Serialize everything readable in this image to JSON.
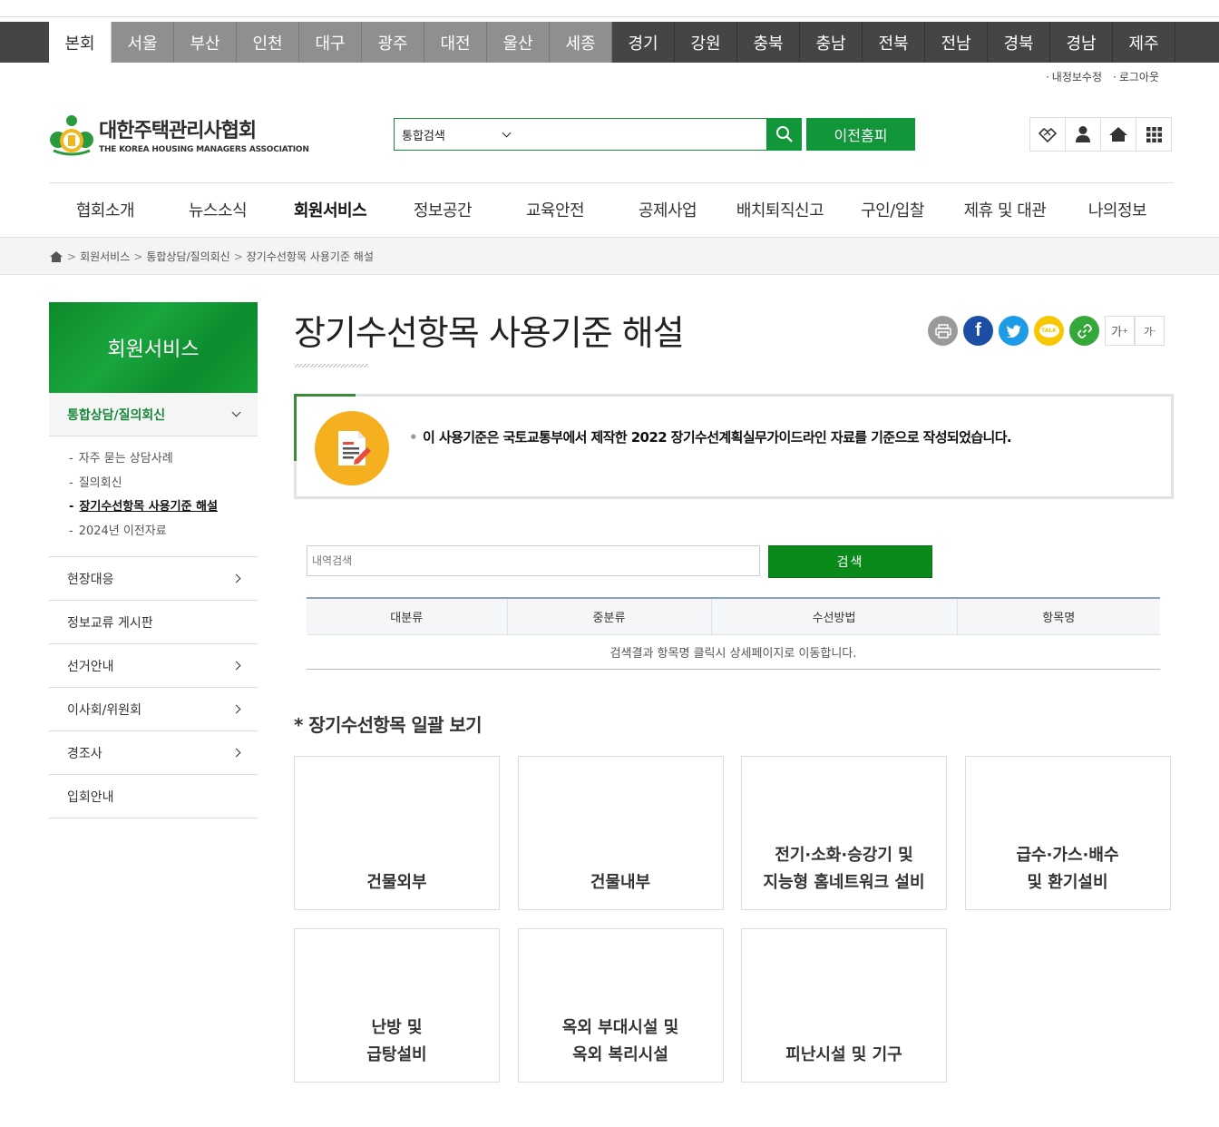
{
  "regions": [
    "본회",
    "서울",
    "부산",
    "인천",
    "대구",
    "광주",
    "대전",
    "울산",
    "세종",
    "경기",
    "강원",
    "충북",
    "충남",
    "전북",
    "전남",
    "경북",
    "경남",
    "제주"
  ],
  "util_links": {
    "edit_info": "내정보수정",
    "logout": "로그아웃"
  },
  "logo": {
    "name_ko": "대한주택관리사협회",
    "name_en": "THE KOREA HOUSING MANAGERS ASSOCIATION"
  },
  "search": {
    "scope": "통합검색",
    "prev_home": "이전홈피"
  },
  "gnb": [
    "협회소개",
    "뉴스소식",
    "회원서비스",
    "정보공간",
    "교육안전",
    "공제사업",
    "배치퇴직신고",
    "구인/입찰",
    "제휴 및 대관",
    "나의정보"
  ],
  "breadcrumb": [
    "회원서비스",
    "통합상담/질의회신",
    "장기수선항목 사용기준 해설"
  ],
  "sidebar": {
    "title": "회원서비스",
    "active": "통합상담/질의회신",
    "sub": [
      "자주 묻는 상담사례",
      "질의회신",
      "장기수선항목 사용기준 해설",
      "2024년 이전자료"
    ],
    "items": [
      {
        "label": "현장대응",
        "arrow": true
      },
      {
        "label": "정보교류 게시판",
        "arrow": false
      },
      {
        "label": "선거안내",
        "arrow": true
      },
      {
        "label": "이사회/위원회",
        "arrow": true
      },
      {
        "label": "경조사",
        "arrow": true
      },
      {
        "label": "입회안내",
        "arrow": false
      }
    ]
  },
  "page": {
    "title": "장기수선항목 사용기준 해설",
    "notice": "이 사용기준은 국토교통부에서 제작한 2022 장기수선계획실무가이드라인 자료를 기준으로 작성되었습니다.",
    "font_up": "가",
    "font_down": "가"
  },
  "history_search": {
    "placeholder": "내역검색",
    "button": "검색"
  },
  "table": {
    "headers": [
      "대분류",
      "중분류",
      "수선방법",
      "항목명"
    ],
    "empty_message": "검색결과 항목명 클릭시 상세페이지로 이동합니다."
  },
  "section": {
    "title": "* 장기수선항목 일괄 보기"
  },
  "categories": [
    "건물외부",
    "건물내부",
    "전기·소화·승강기 및\n지능형 홈네트워크 설비",
    "급수·가스·배수\n및 환기설비",
    "난방 및\n급탕설비",
    "옥외 부대시설 및\n옥외 복리시설",
    "피난시설 및 기구"
  ]
}
